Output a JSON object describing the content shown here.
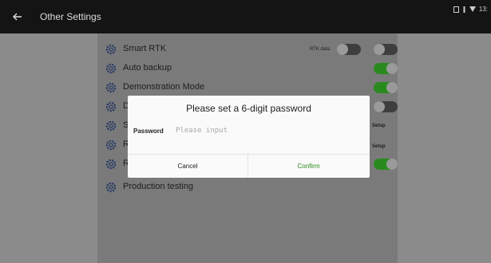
{
  "header": {
    "title": "Other Settings",
    "back_icon": "arrow-left-icon",
    "status": {
      "icons": [
        "sim-icon",
        "signal-icon",
        "wifi-icon"
      ],
      "time": "13:"
    }
  },
  "settings": [
    {
      "label": "Smart RTK",
      "extra_label": "RTK data",
      "extra_toggle": false,
      "toggle": false
    },
    {
      "label": "Auto backup",
      "toggle": true
    },
    {
      "label": "Demonstration Mode",
      "toggle": true
    },
    {
      "label": "D",
      "toggle": false
    },
    {
      "label": "S",
      "action": "Setup"
    },
    {
      "label": "R",
      "action": "Setup"
    },
    {
      "label": "R",
      "toggle": true
    },
    {
      "label": "Production testing"
    }
  ],
  "dialog": {
    "title": "Please set a 6-digit password",
    "password_label": "Password",
    "password_value": "",
    "password_placeholder": "Please input",
    "cancel": "Cancel",
    "confirm": "Confirm"
  },
  "colors": {
    "accent": "#2a8a1e",
    "topbar": "#141414",
    "overlay": "#8b8b8b",
    "dialog": "#fafafa"
  }
}
